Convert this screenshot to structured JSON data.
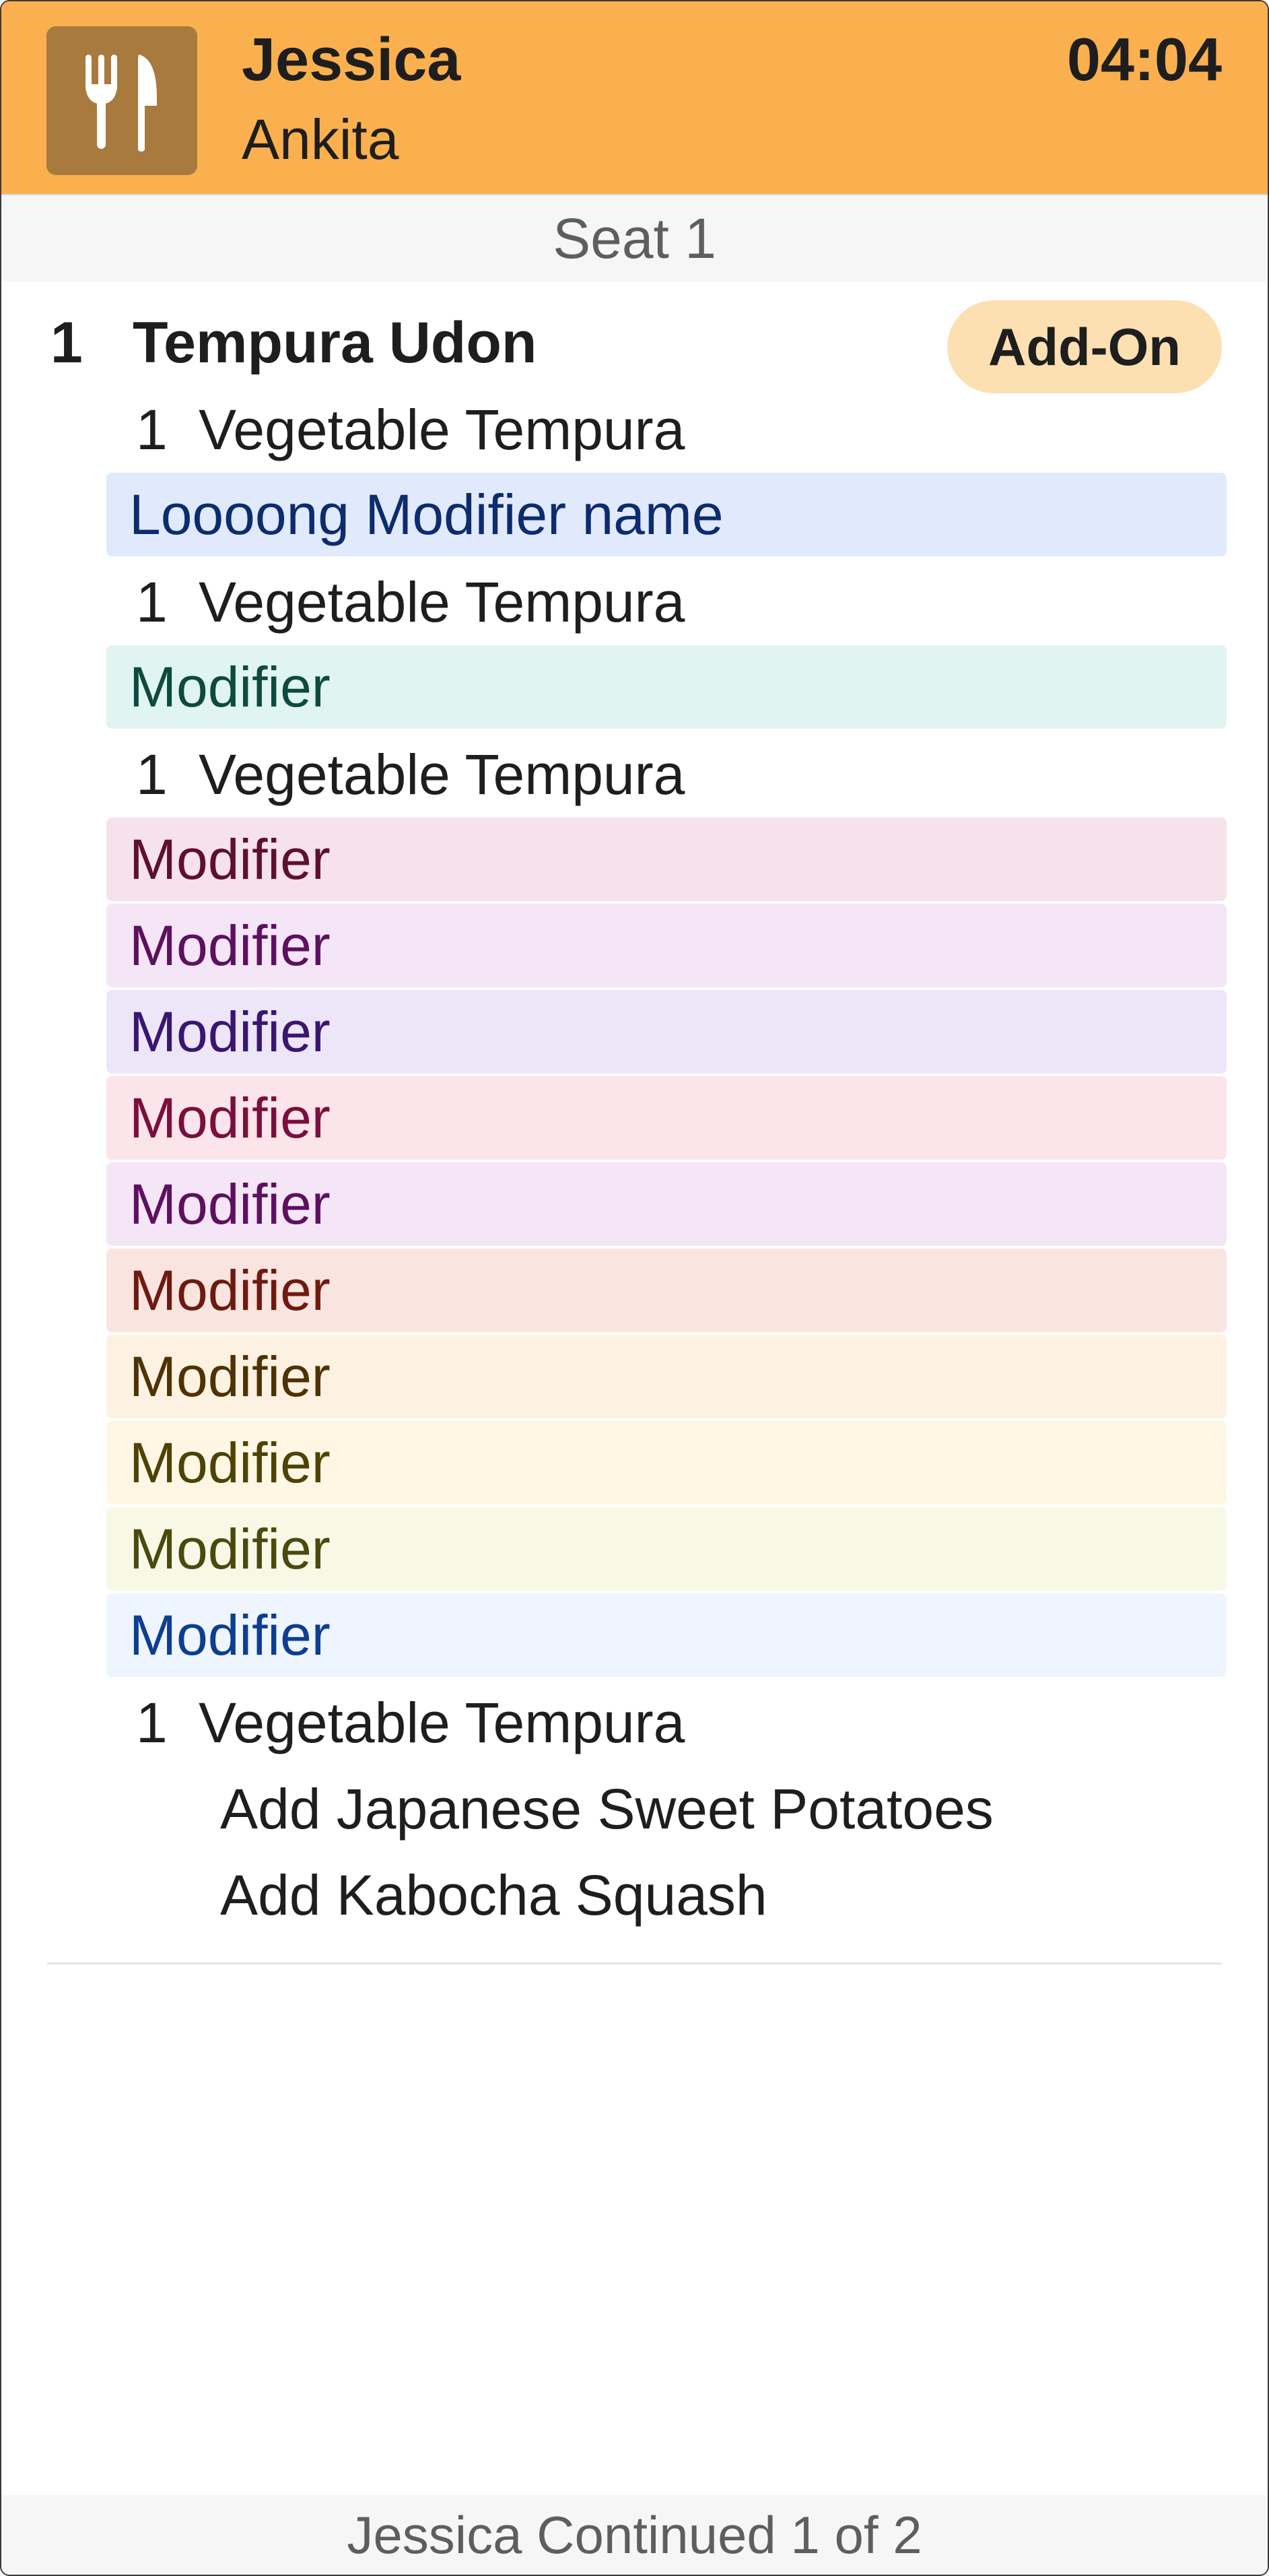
{
  "header": {
    "icon": "fork-knife-icon",
    "server_name": "Jessica",
    "guest_name": "Ankita",
    "timer": "04:04",
    "accent_color": "#fbb04f"
  },
  "seat": {
    "label": "Seat 1"
  },
  "order": {
    "quantity": "1",
    "name": "Tempura Udon",
    "addon_label": "Add-On",
    "sub_items": [
      {
        "quantity": "1",
        "name": "Vegetable Tempura",
        "modifiers": [
          {
            "text": "Loooong Modifier name",
            "bg": "#e1eafc",
            "fg": "#0d2c6e"
          }
        ],
        "notes": []
      },
      {
        "quantity": "1",
        "name": "Vegetable Tempura",
        "modifiers": [
          {
            "text": "Modifier",
            "bg": "#e0f4f2",
            "fg": "#0d4a3f"
          }
        ],
        "notes": []
      },
      {
        "quantity": "1",
        "name": "Vegetable Tempura",
        "modifiers": [
          {
            "text": "Modifier",
            "bg": "#f6e2eb",
            "fg": "#5e1030"
          },
          {
            "text": "Modifier",
            "bg": "#f4e6f7",
            "fg": "#5e1060"
          },
          {
            "text": "Modifier",
            "bg": "#ece6f8",
            "fg": "#3a1670"
          },
          {
            "text": "Modifier",
            "bg": "#fbe4ea",
            "fg": "#7a0f3c"
          },
          {
            "text": "Modifier",
            "bg": "#f4e6f7",
            "fg": "#5e1060"
          },
          {
            "text": "Modifier",
            "bg": "#f9e4e0",
            "fg": "#6e1a10"
          },
          {
            "text": "Modifier",
            "bg": "#fdf2e2",
            "fg": "#4e3206"
          },
          {
            "text": "Modifier",
            "bg": "#fff7e4",
            "fg": "#4e4206"
          },
          {
            "text": "Modifier",
            "bg": "#f7f8e6",
            "fg": "#4a4a0e"
          },
          {
            "text": "Modifier",
            "bg": "#eef5fe",
            "fg": "#0d3e90"
          }
        ],
        "notes": []
      },
      {
        "quantity": "1",
        "name": "Vegetable Tempura",
        "modifiers": [],
        "notes": [
          "Add Japanese Sweet Potatoes",
          "Add Kabocha Squash"
        ]
      }
    ]
  },
  "footer": {
    "label": "Jessica Continued 1 of 2"
  }
}
